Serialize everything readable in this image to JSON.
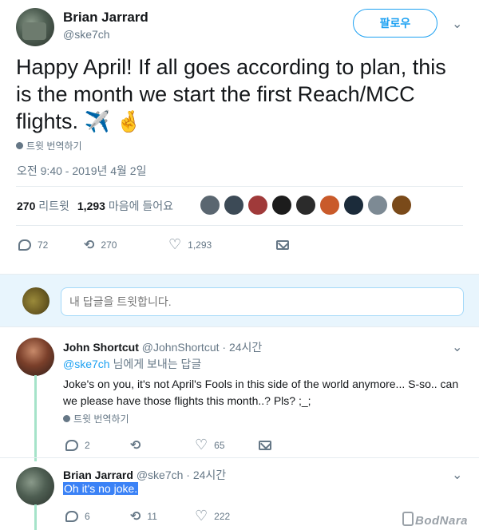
{
  "tweet": {
    "author_name": "Brian Jarrard",
    "author_handle": "@ske7ch",
    "follow_label": "팔로우",
    "text": "Happy April! If all goes according to plan, this is the month we start the first Reach/MCC flights.",
    "emoji": "✈️ 🤞",
    "translate_label": "트윗 번역하기",
    "timestamp": "오전 9:40 - 2019년 4월 2일",
    "retweet_count": "270",
    "retweet_label": "리트윗",
    "like_count": "1,293",
    "like_label": "마음에 들어요",
    "actions": {
      "reply": "72",
      "retweet": "270",
      "like": "1,293"
    },
    "likers": [
      "#5a6670",
      "#3c4a56",
      "#a03a3a",
      "#1c1c1c",
      "#2b2b2b",
      "#c95a2a",
      "#1b2b3a",
      "#7d8a94",
      "#7a4a1a"
    ]
  },
  "reply_box": {
    "placeholder": "내 답글을 트윗합니다."
  },
  "replies": [
    {
      "name": "John Shortcut",
      "handle": "@JohnShortcut",
      "time": "· 24시간",
      "to_mention": "@ske7ch",
      "to_suffix": " 님에게 보내는 답글",
      "text": "Joke's on you, it's not April's Fools in this side of the world anymore... S-so.. can we please have those flights this month..? Pls? ;_;",
      "translate_label": "트윗 번역하기",
      "actions": {
        "reply": "2",
        "retweet": "",
        "like": "65"
      }
    },
    {
      "name": "Brian Jarrard",
      "handle": "@ske7ch",
      "time": "· 24시간",
      "text": "Oh it's no joke.",
      "actions": {
        "reply": "6",
        "retweet": "11",
        "like": "222"
      }
    }
  ],
  "watermark": "BodNara"
}
